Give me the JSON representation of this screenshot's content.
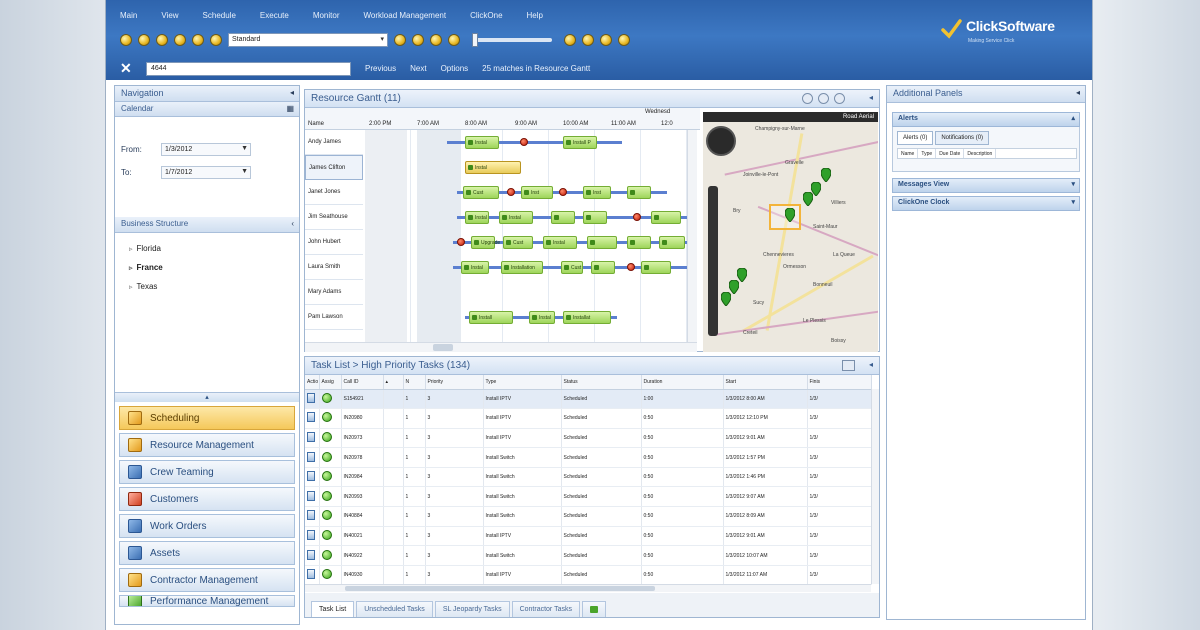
{
  "menu": [
    "Main",
    "View",
    "Schedule",
    "Execute",
    "Monitor",
    "Workload Management",
    "ClickOne",
    "Help"
  ],
  "toolbar": {
    "view_select": "Standard"
  },
  "search": {
    "value": "4644",
    "previous": "Previous",
    "next": "Next",
    "options": "Options",
    "matches": "25 matches in Resource Gantt"
  },
  "brand": {
    "name": "ClickSoftware",
    "tagline": "Making Service Click"
  },
  "left": {
    "navigation": "Navigation",
    "calendar": "Calendar",
    "from_label": "From:",
    "from_value": "1/3/2012",
    "to_label": "To:",
    "to_value": "1/7/2012",
    "business_structure": "Business Structure",
    "tree": [
      "Florida",
      "France",
      "Texas"
    ],
    "nav_buttons": [
      "Scheduling",
      "Resource Management",
      "Crew Teaming",
      "Customers",
      "Work Orders",
      "Assets",
      "Contractor Management",
      "Performance Management"
    ]
  },
  "gantt": {
    "title": "Resource Gantt (11)",
    "date_label": "Wednesd",
    "name_col": "Name",
    "times": [
      "2:00 PM",
      "7:00 AM",
      "8:00 AM",
      "9:00 AM",
      "10:00 AM",
      "11:00 AM",
      "12:0"
    ],
    "resources": [
      "Andy James",
      "James Clifton",
      "Janet Jones",
      "Jim Seathouse",
      "John Hubert",
      "Laura Smith",
      "Mary Adams",
      "Pam Lawson"
    ],
    "task_labels": [
      "Instal",
      "Install P",
      "Instal",
      "Cust",
      "Inst",
      "Inst",
      "Instal",
      "Instal",
      "Upgrade",
      "Cust",
      "Instal",
      "Instal",
      "Instal",
      "Installation",
      "Cust",
      "Instal",
      "Instal",
      "Instal",
      "Install",
      "Installat"
    ]
  },
  "map": {
    "top": "Road  Aerial",
    "places": [
      "Champigny-sur-Marne",
      "Gravelle",
      "Joinville-le-Pont",
      "Bry",
      "Saint-Maur",
      "Chennevieres",
      "Ormesson",
      "Bonneuil",
      "Sucy",
      "Le Plessis",
      "Villiers",
      "Creteil",
      "Boissy",
      "La Queue"
    ]
  },
  "tasks": {
    "title": "Task List > High Priority Tasks (134)",
    "columns": [
      "Actio",
      "Assig",
      "Call ID",
      "",
      "N",
      "Priority",
      "Type",
      "Status",
      "Duration",
      "Start",
      "Finis"
    ],
    "rows": [
      [
        "S154921",
        "1",
        "3",
        "Install IPTV",
        "Scheduled",
        "1:00",
        "1/3/2012 8:00 AM",
        "1/3/"
      ],
      [
        "IN20980",
        "1",
        "3",
        "Install IPTV",
        "Scheduled",
        "0:50",
        "1/3/2012 12:10 PM",
        "1/3/"
      ],
      [
        "IN20973",
        "1",
        "3",
        "Install IPTV",
        "Scheduled",
        "0:50",
        "1/3/2012 9:01 AM",
        "1/3/"
      ],
      [
        "IN20978",
        "1",
        "3",
        "Install Switch",
        "Scheduled",
        "0:50",
        "1/3/2012 1:57 PM",
        "1/3/"
      ],
      [
        "IN20984",
        "1",
        "3",
        "Install Switch",
        "Scheduled",
        "0:50",
        "1/3/2012 1:46 PM",
        "1/3/"
      ],
      [
        "IN20993",
        "1",
        "3",
        "Install Switch",
        "Scheduled",
        "0:50",
        "1/3/2012 9:07 AM",
        "1/3/"
      ],
      [
        "IN40884",
        "1",
        "3",
        "Install Switch",
        "Scheduled",
        "0:50",
        "1/3/2012 8:09 AM",
        "1/3/"
      ],
      [
        "IN40021",
        "1",
        "3",
        "Install IPTV",
        "Scheduled",
        "0:50",
        "1/3/2012 9:01 AM",
        "1/3/"
      ],
      [
        "IN40922",
        "1",
        "3",
        "Install Switch",
        "Scheduled",
        "0:50",
        "1/3/2012 10:07 AM",
        "1/3/"
      ],
      [
        "IN40930",
        "1",
        "3",
        "Install IPTV",
        "Scheduled",
        "0:50",
        "1/3/2012 11:07 AM",
        "1/3/"
      ]
    ],
    "tabs": [
      "Task List",
      "Unscheduled Tasks",
      "SL Jeopardy Tasks",
      "Contractor Tasks"
    ]
  },
  "right": {
    "title": "Additional Panels",
    "alerts": "Alerts",
    "alerts_tab": "Alerts (0)",
    "notifications_tab": "Notifications (0)",
    "alert_cols": [
      "Name",
      "Type",
      "Due Date",
      "Description"
    ],
    "messages": "Messages View",
    "clickone": "ClickOne Clock"
  }
}
